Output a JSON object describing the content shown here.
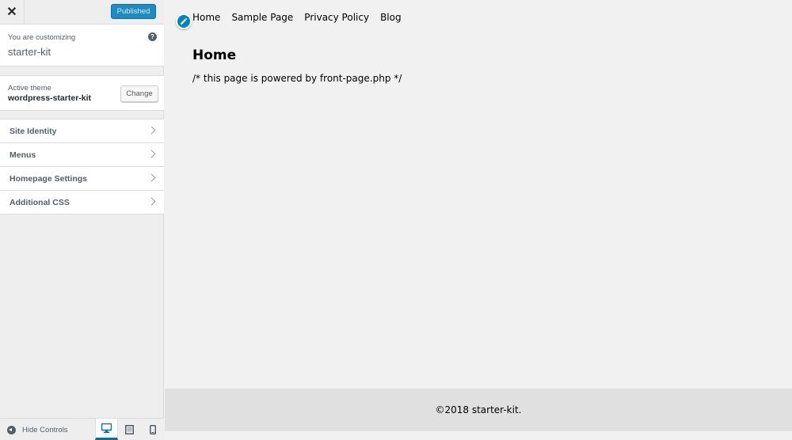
{
  "header": {
    "close_label": "✕",
    "publish_label": "Published"
  },
  "info": {
    "customizing_label": "You are customizing",
    "site_name": "starter-kit",
    "help_label": "?"
  },
  "theme": {
    "label": "Active theme",
    "name": "wordpress-starter-kit",
    "change_label": "Change"
  },
  "sections": [
    {
      "label": "Site Identity"
    },
    {
      "label": "Menus"
    },
    {
      "label": "Homepage Settings"
    },
    {
      "label": "Additional CSS"
    }
  ],
  "footer": {
    "hide_controls_label": "Hide Controls",
    "devices": [
      "desktop",
      "tablet",
      "mobile"
    ],
    "active_device": "desktop"
  },
  "preview": {
    "nav": [
      "Home",
      "Sample Page",
      "Privacy Policy",
      "Blog"
    ],
    "page_title": "Home",
    "page_content": "/* this page is powered by front-page.php */",
    "footer_text": "©2018 starter-kit."
  },
  "colors": {
    "accent": "#0073aa",
    "publish_button": "#1e8cbe",
    "edit_shortcut": "#0085ba",
    "sidebar_bg": "#eeeeee",
    "preview_bg": "#f1f1f1",
    "preview_footer_bg": "#e0e0e0"
  },
  "icons": [
    "close-icon",
    "help-icon",
    "chevron-right-icon",
    "hide-controls-icon",
    "desktop-icon",
    "tablet-icon",
    "mobile-icon",
    "pencil-icon"
  ]
}
